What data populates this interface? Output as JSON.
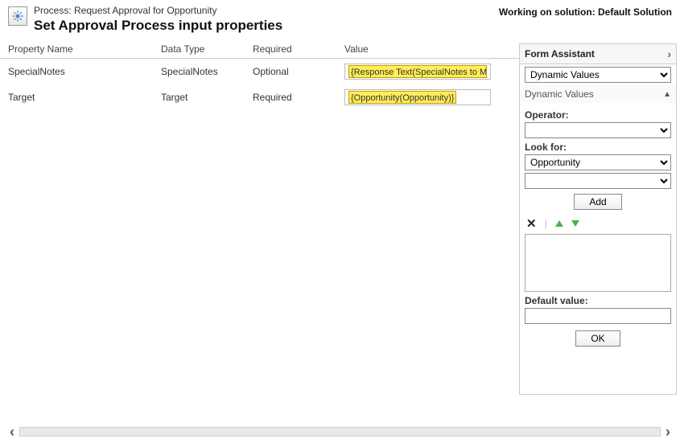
{
  "header": {
    "process_label": "Process: Request Approval for Opportunity",
    "title": "Set Approval Process input properties",
    "working_on": "Working on solution: Default Solution"
  },
  "columns": {
    "name": "Property Name",
    "type": "Data Type",
    "required": "Required",
    "value": "Value"
  },
  "rows": [
    {
      "name": "SpecialNotes",
      "type": "SpecialNotes",
      "required": "Optional",
      "value": "{Response Text(SpecialNotes to Manager)}"
    },
    {
      "name": "Target",
      "type": "Target",
      "required": "Required",
      "value": "{Opportunity(Opportunity)}"
    }
  ],
  "form_assistant": {
    "title": "Form Assistant",
    "mode": "Dynamic Values",
    "section": "Dynamic Values",
    "operator_label": "Operator:",
    "operator_value": "",
    "lookfor_label": "Look for:",
    "lookfor_entity": "Opportunity",
    "lookfor_attr": "",
    "add_label": "Add",
    "default_label": "Default value:",
    "ok_label": "OK"
  }
}
